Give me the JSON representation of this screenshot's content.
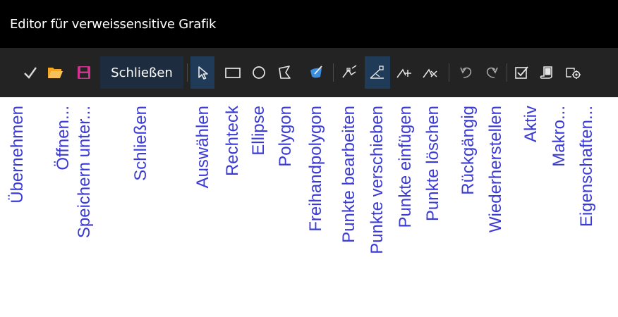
{
  "window": {
    "title": "Editor für verweissensitive Grafik"
  },
  "toolbar": {
    "close_label": "Schließen",
    "icons": {
      "apply": "check-icon",
      "open": "folder-icon",
      "save_as": "floppy-disk-icon",
      "select": "arrow-pointer-icon",
      "rectangle": "rectangle-icon",
      "ellipse": "ellipse-icon",
      "polygon": "polygon-icon",
      "freehand": "freehand-polygon-icon",
      "edit_points": "edit-points-icon",
      "move_points": "move-points-icon",
      "insert_points": "insert-points-icon",
      "delete_points": "delete-points-icon",
      "undo": "undo-icon",
      "redo": "redo-icon",
      "active": "checkbox-icon",
      "macro": "macro-icon",
      "properties": "properties-icon"
    }
  },
  "labels": {
    "apply": "Übernehmen",
    "open": "Öffnen...",
    "save_as": "Speichern unter...",
    "close": "Schließen",
    "select": "Auswählen",
    "rectangle": "Rechteck",
    "ellipse": "Ellipse",
    "polygon": "Polygon",
    "freehand": "Freihandpolygon",
    "edit_points": "Punkte bearbeiten",
    "move_points": "Punkte verschieben",
    "insert_points": "Punkte einfügen",
    "delete_points": "Punkte löschen",
    "undo": "Rückgängig",
    "redo": "Wiederherstellen",
    "active": "Aktiv",
    "macro": "Makro...",
    "properties": "Eigenschaften..."
  },
  "colors": {
    "titlebar": "#000000",
    "toolbar": "#232323",
    "selected": "#1f3b57",
    "label_text": "#3a3ad6",
    "open_icon": "#f5a623",
    "save_icon": "#d0328f",
    "freehand_icon": "#3a8fe0"
  }
}
